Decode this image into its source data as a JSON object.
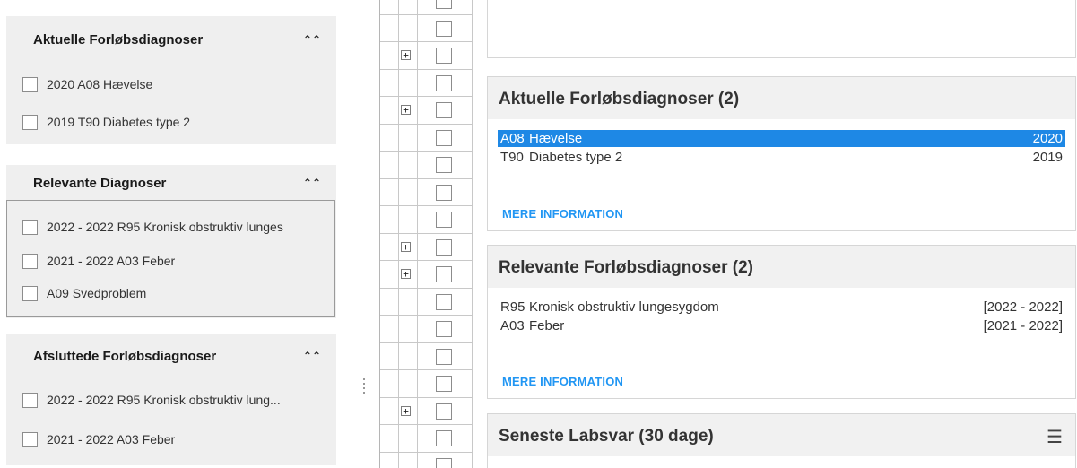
{
  "left": {
    "aktuelle": {
      "title": "Aktuelle Forløbsdiagnoser",
      "items": [
        "2020 A08 Hævelse",
        "2019 T90 Diabetes type 2"
      ]
    },
    "relevante": {
      "title": "Relevante Diagnoser",
      "items": [
        "2022 - 2022 R95 Kronisk obstruktiv lunges",
        "2021 - 2022 A03 Feber",
        "A09 Svedproblem"
      ]
    },
    "afsluttede": {
      "title": "Afsluttede Forløbsdiagnoser",
      "items": [
        "2022 - 2022 R95 Kronisk obstruktiv lung...",
        "2021 - 2022 A03 Feber"
      ]
    },
    "collapse_glyph": "»"
  },
  "right": {
    "aktuelle": {
      "title": "Aktuelle Forløbsdiagnoser (2)",
      "rows": [
        {
          "code": "A08",
          "name": "Hævelse",
          "value": "2020",
          "selected": true
        },
        {
          "code": "T90",
          "name": "Diabetes type 2",
          "value": "2019",
          "selected": false
        }
      ],
      "more": "MERE INFORMATION"
    },
    "relevante": {
      "title": "Relevante Forløbsdiagnoser (2)",
      "rows": [
        {
          "code": "R95",
          "name": "Kronisk obstruktiv lungesygdom",
          "value": "[2022 - 2022]"
        },
        {
          "code": "A03",
          "name": "Feber",
          "value": "[2021 - 2022]"
        }
      ],
      "more": "MERE INFORMATION"
    },
    "labsvar": {
      "title": "Seneste Labsvar (30 dage)",
      "menu_icon": "hamburger-icon"
    }
  },
  "grid": {
    "plus_glyph": "+",
    "plus_rows": [
      2,
      4,
      9,
      10,
      15
    ]
  },
  "colors": {
    "selection": "#1e88e5",
    "link": "#2196f3",
    "panel_bg": "#efefef",
    "header_bg": "#f1f1f1"
  }
}
